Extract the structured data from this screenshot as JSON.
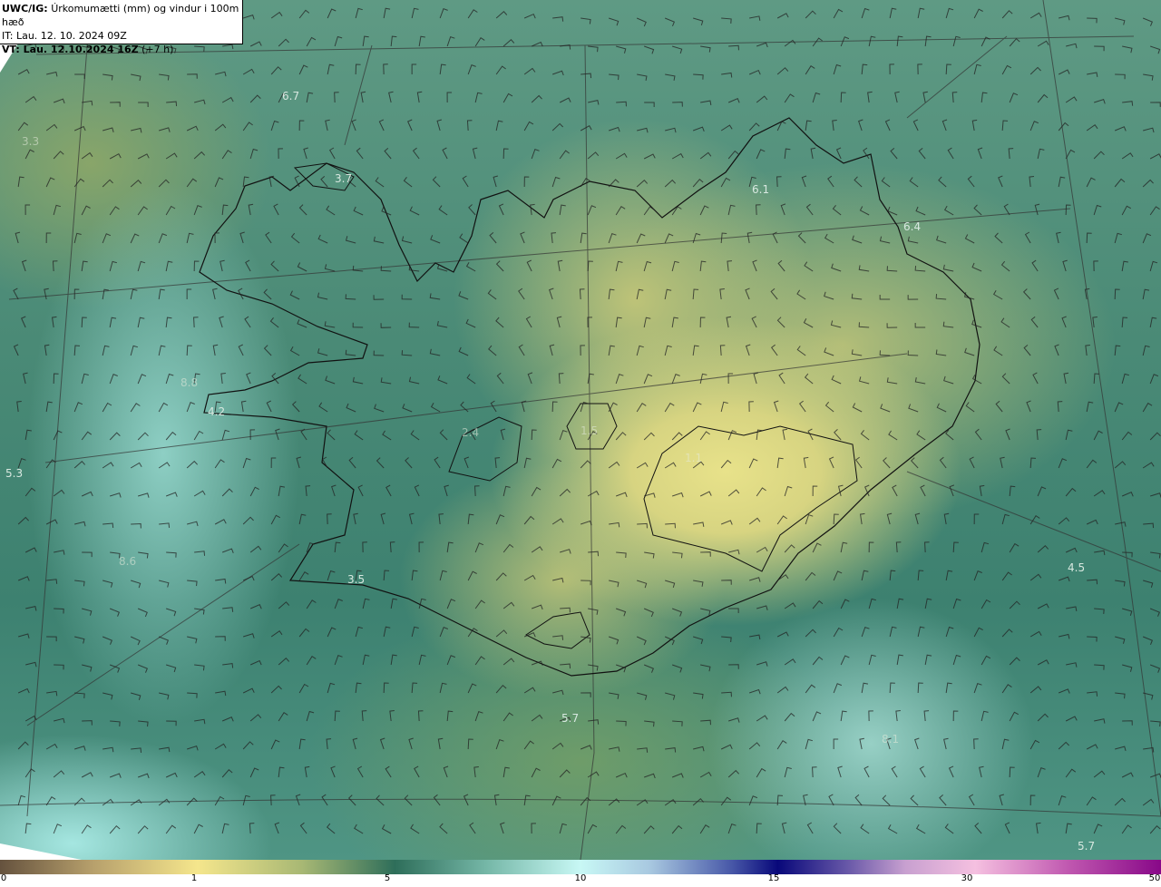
{
  "title": {
    "model": "UWC/IG:",
    "description": "Úrkomumætti (mm) og vindur i 100m hæð",
    "it": "IT: Lau. 12. 10. 2024 09Z",
    "vt": "VT: Lau. 12.10.2024 16Z",
    "lead": "(+7 h)"
  },
  "values": [
    "6.7",
    "3.3",
    "3.7",
    "6.1",
    "6.4",
    "8.8",
    "4.2",
    "2.4",
    "1.5",
    "1.1",
    "5.3",
    "8.6",
    "3.5",
    "4.5",
    "5.7",
    "8.1",
    "5.7"
  ],
  "colorbar": {
    "unit": "mm",
    "ticks": [
      "0",
      "1",
      "5",
      "10",
      "15",
      "30",
      "50"
    ],
    "colors": [
      "#65523e",
      "#f5e68c",
      "#2e6e5a",
      "#c8f8f5",
      "#08087a",
      "#f5c0e0",
      "#880888"
    ]
  }
}
